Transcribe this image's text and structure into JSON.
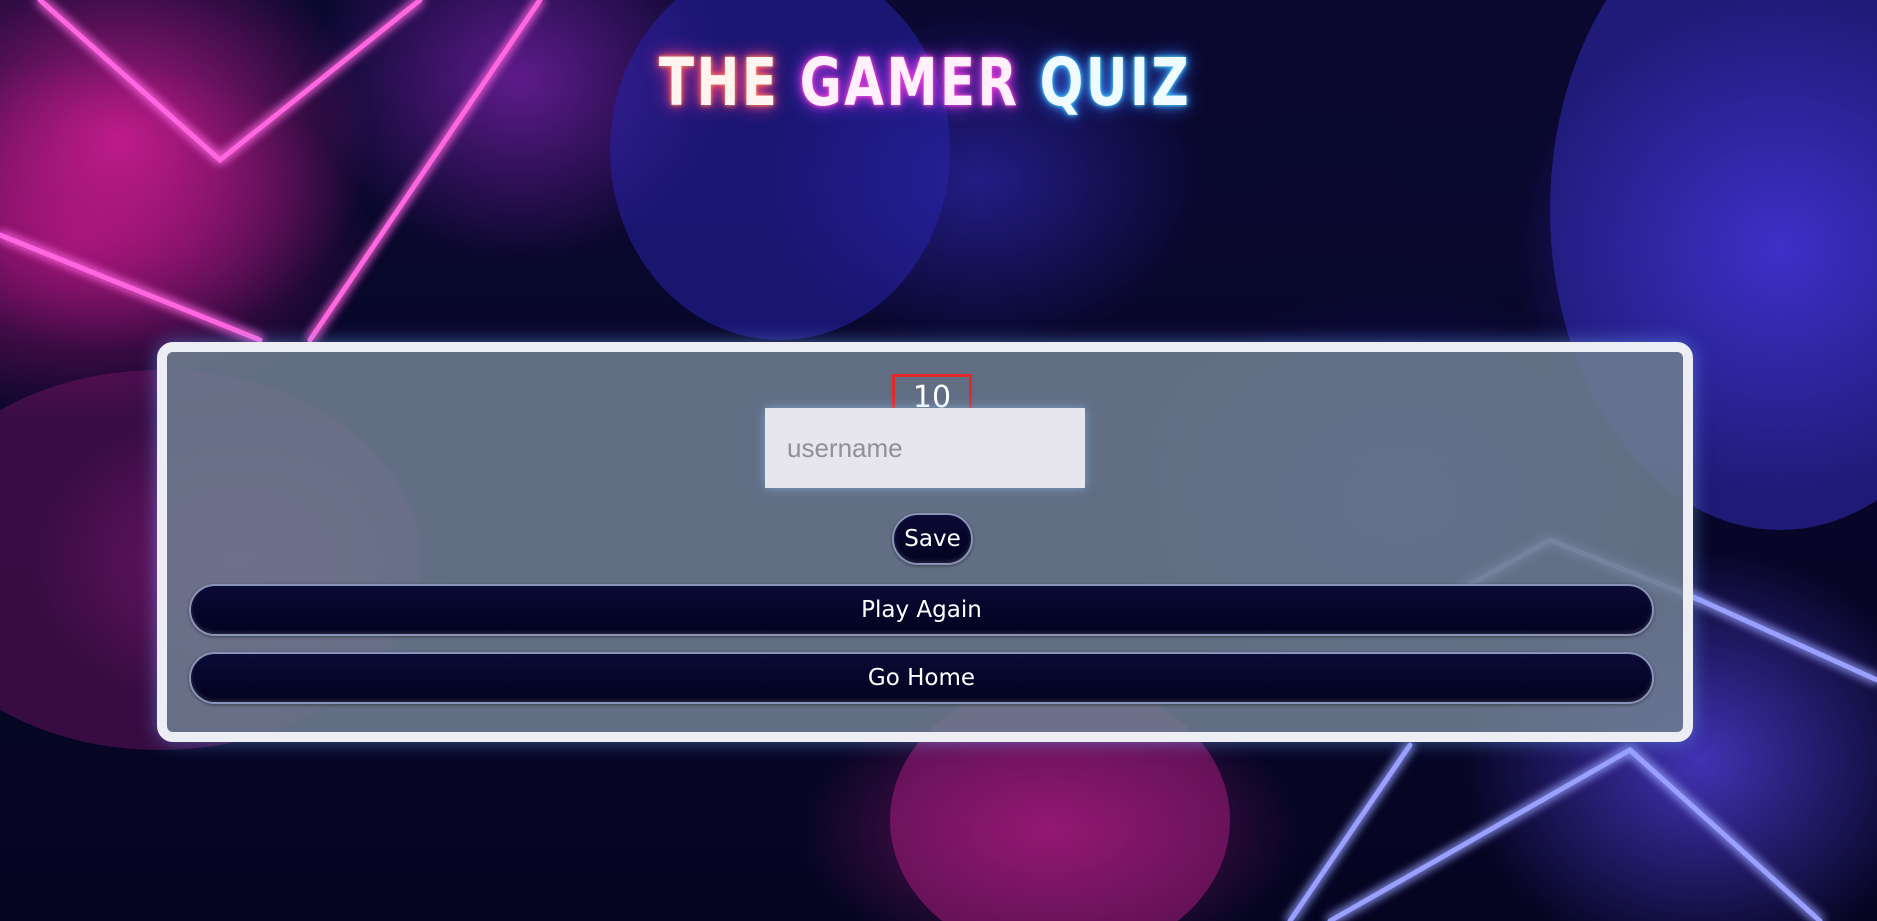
{
  "header": {
    "title_words": [
      "THE",
      "GAMER",
      "QUIZ"
    ]
  },
  "result": {
    "score": "10"
  },
  "form": {
    "username_placeholder": "username",
    "username_value": "",
    "save_label": "Save"
  },
  "actions": {
    "play_again_label": "Play Again",
    "go_home_label": "Go Home"
  },
  "colors": {
    "card_border": "#eceef3",
    "card_fill": "#6e7d91",
    "button_fill": "#020220",
    "score_highlight": "#e02a2a",
    "neon_pink": "#ff3ad8",
    "neon_blue": "#5a6aff"
  }
}
